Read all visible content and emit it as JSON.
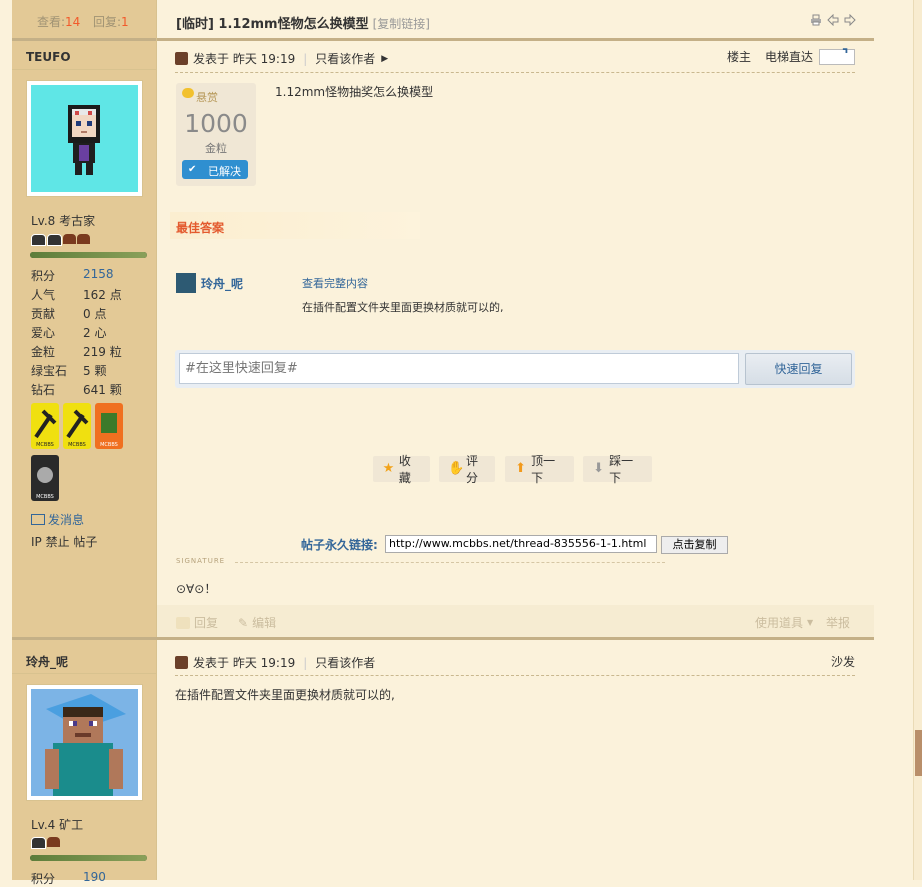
{
  "thread": {
    "views_label": "查看:",
    "views": "14",
    "replies_label": "回复:",
    "replies": "1",
    "title": "[临时] 1.12mm怪物怎么换模型",
    "copy_link": "[复制链接]"
  },
  "post1": {
    "author": "TEUFO",
    "level": "Lv.8 考古家",
    "stats": [
      {
        "label": "积分",
        "value": "2158"
      },
      {
        "label": "人气",
        "value": "162 点"
      },
      {
        "label": "贡献",
        "value": "0 点"
      },
      {
        "label": "爱心",
        "value": "2 心"
      },
      {
        "label": "金粒",
        "value": "219 粒"
      },
      {
        "label": "绿宝石",
        "value": "5 颗"
      },
      {
        "label": "钻石",
        "value": "641 颗"
      }
    ],
    "medal_label": "MCBBS",
    "send_pm": "发消息",
    "ip_ban": "IP 禁止 帖子",
    "posted": "发表于 昨天 19:19",
    "only_author": "只看该作者",
    "floor": "楼主",
    "elevator": "电梯直达",
    "bounty_label": "悬赏",
    "bounty_amount": "1000",
    "bounty_unit": "金粒",
    "solved": "已解决",
    "content": "1.12mm怪物抽奖怎么换模型",
    "best_answer_label": "最佳答案",
    "best_answer_user": "玲舟_呢",
    "view_full": "查看完整内容",
    "best_answer_text": "在插件配置文件夹里面更换材质就可以的,",
    "reply_placeholder": "#在这里快速回复#",
    "reply_button": "快速回复",
    "actions": [
      "收藏",
      "评分",
      "顶一下",
      "踩一下"
    ],
    "permalink_label": "帖子永久链接:",
    "permalink": "http://www.mcbbs.net/thread-835556-1-1.html",
    "copy_button": "点击复制",
    "signature_label": "SIGNATURE",
    "signature": "⊙∀⊙！",
    "footer": {
      "reply": "回复",
      "edit": "编辑",
      "use_item": "使用道具",
      "report": "举报"
    }
  },
  "post2": {
    "author": "玲舟_呢",
    "level": "Lv.4 矿工",
    "stats": [
      {
        "label": "积分",
        "value": "190"
      }
    ],
    "posted": "发表于 昨天 19:19",
    "only_author": "只看该作者",
    "floor": "沙发",
    "content": "在插件配置文件夹里面更换材质就可以的,"
  },
  "colors": {
    "accent": "#336699",
    "highlight": "#f25a2b",
    "sidebar": "#e3c996",
    "background": "#fbf2db"
  }
}
